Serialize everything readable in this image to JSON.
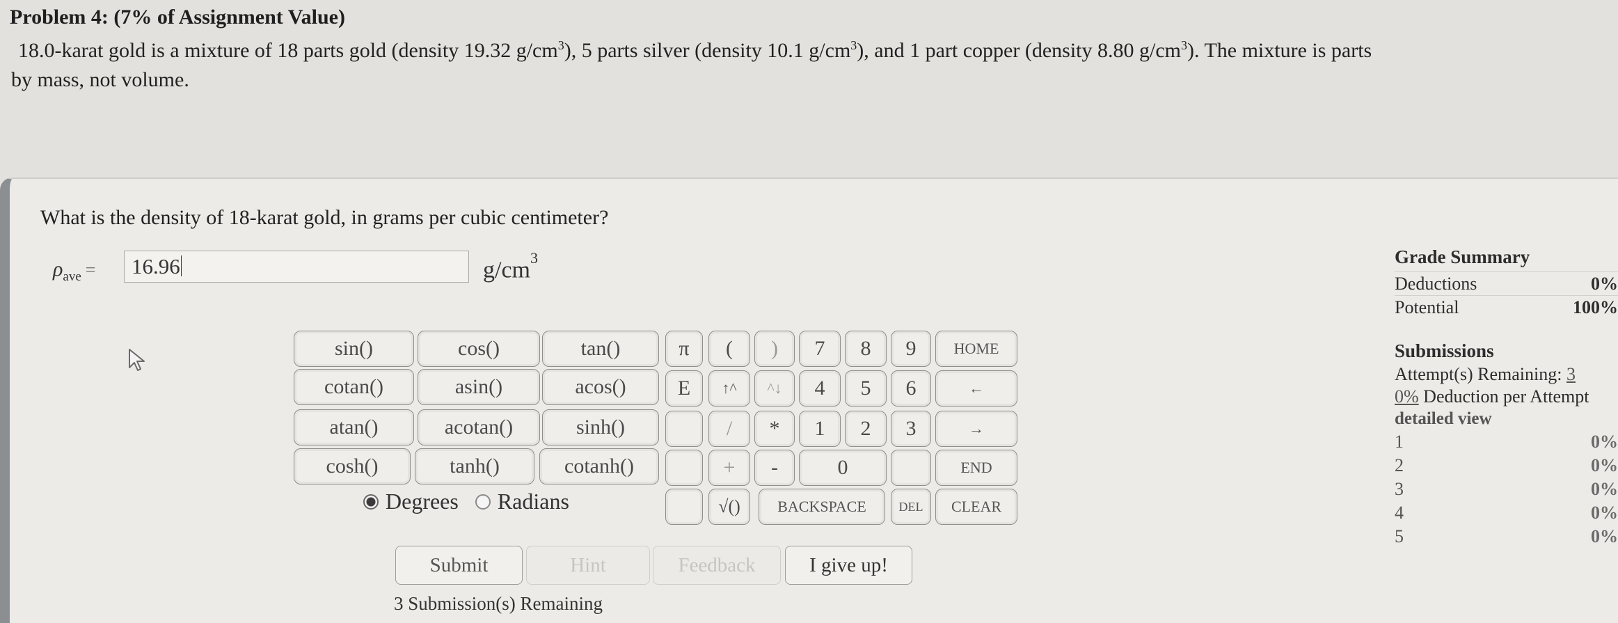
{
  "problem": {
    "title": "Problem 4: (7% of Assignment Value)",
    "text_line1_a": "18.0-karat gold is a mixture of 18 parts gold (density 19.32 g/cm",
    "text_line1_b": "), 5 parts silver (density 10.1 g/cm",
    "text_line1_c": "), and 1 part copper (density 8.80 g/cm",
    "text_line1_d": "). The mixture is parts",
    "text_line2": "by mass, not volume.",
    "exp": "3"
  },
  "question": {
    "text": "What is the density of 18-karat gold, in grams per cubic centimeter?",
    "symbol": "ρ",
    "symbol_sub": "ave",
    "equals": "=",
    "answer_value": "16.96",
    "unit": "g/cm",
    "unit_exp": "3"
  },
  "keypad": {
    "functions": [
      [
        "sin()",
        "cos()",
        "tan()"
      ],
      [
        "cotan()",
        "asin()",
        "acos()"
      ],
      [
        "atan()",
        "acotan()",
        "sinh()"
      ],
      [
        "cosh()",
        "tanh()",
        "cotanh()"
      ]
    ],
    "symbols": {
      "pi": "π",
      "lparen": "(",
      "rparen": ")",
      "e": "E",
      "up": "↑^",
      "down": "^↓",
      "slash": "/",
      "star": "*",
      "plus": "+",
      "minus": "-",
      "sqrt": "√()"
    },
    "digits": [
      "7",
      "8",
      "9",
      "4",
      "5",
      "6",
      "1",
      "2",
      "3",
      "0"
    ],
    "nav": {
      "home": "HOME",
      "left": "←",
      "right": "→",
      "end": "END",
      "backspace": "BACKSPACE",
      "del": "DEL",
      "clear": "CLEAR"
    },
    "angle": {
      "degrees": "Degrees",
      "radians": "Radians",
      "selected": "degrees"
    }
  },
  "actions": {
    "submit": "Submit",
    "hint": "Hint",
    "feedback": "Feedback",
    "give_up": "I give up!",
    "remaining": "3 Submission(s) Remaining"
  },
  "sidebar": {
    "grade_summary": "Grade Summary",
    "deductions_label": "Deductions",
    "deductions_value": "0%",
    "potential_label": "Potential",
    "potential_value": "100%",
    "submissions_title": "Submissions",
    "attempts_label": "Attempt(s) Remaining: ",
    "attempts_value": "3",
    "deduction_pct": "0%",
    "deduction_text": " Deduction per Attempt",
    "detailed_view": "detailed view",
    "attempts": [
      {
        "n": "1",
        "pct": "0%"
      },
      {
        "n": "2",
        "pct": "0%"
      },
      {
        "n": "3",
        "pct": "0%"
      },
      {
        "n": "4",
        "pct": "0%"
      },
      {
        "n": "5",
        "pct": "0%"
      }
    ]
  }
}
